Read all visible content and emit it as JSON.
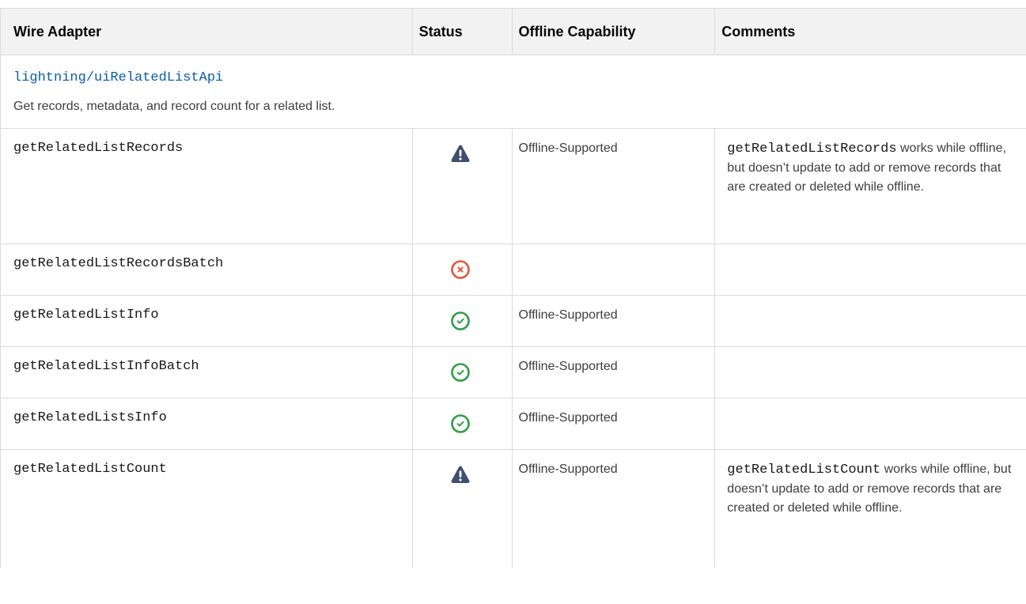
{
  "table": {
    "headers": [
      "Wire Adapter",
      "Status",
      "Offline Capability",
      "Comments"
    ]
  },
  "section": {
    "link": "lightning/uiRelatedListApi",
    "description": "Get records, metadata, and record count for a related list."
  },
  "rows": [
    {
      "adapter": "getRelatedListRecords",
      "status": "warning-icon",
      "capability": "Offline-Supported",
      "comment_code": "getRelatedListRecords",
      "comment_text": " works while offline, but doesn’t update to add or remove records that are created or deleted while offline."
    },
    {
      "adapter": "getRelatedListRecordsBatch",
      "status": "not-supported-icon",
      "capability": "",
      "comment_code": "",
      "comment_text": ""
    },
    {
      "adapter": "getRelatedListInfo",
      "status": "supported-icon",
      "capability": "Offline-Supported",
      "comment_code": "",
      "comment_text": ""
    },
    {
      "adapter": "getRelatedListInfoBatch",
      "status": "supported-icon",
      "capability": "Offline-Supported",
      "comment_code": "",
      "comment_text": ""
    },
    {
      "adapter": "getRelatedListsInfo",
      "status": "supported-icon",
      "capability": "Offline-Supported",
      "comment_code": "",
      "comment_text": ""
    },
    {
      "adapter": "getRelatedListCount",
      "status": "warning-icon",
      "capability": "Offline-Supported",
      "comment_code": "getRelatedListCount",
      "comment_text": " works while offline, but doesn’t update to add or remove records that are created or deleted while offline."
    }
  ],
  "colors": {
    "link": "#0b5cab",
    "warning": "#3e4f73",
    "error": "#e4563b",
    "success": "#2e9e47",
    "header_bg": "#f3f2f2",
    "border": "#dddbda"
  }
}
